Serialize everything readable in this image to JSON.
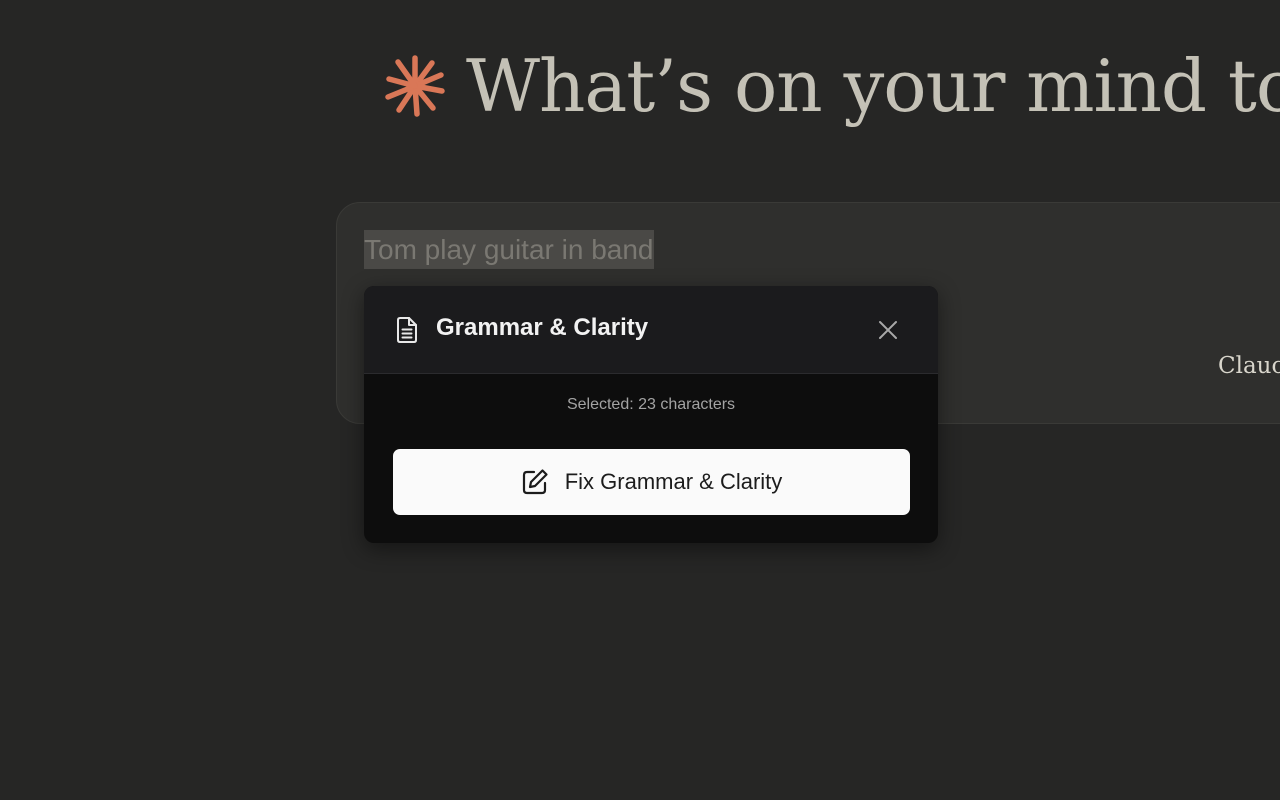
{
  "greeting": {
    "text": "What’s on your mind to",
    "logo_icon": "sparkle-asterisk-icon",
    "logo_color": "#d97757"
  },
  "composer": {
    "input_text": "Tom play guitar in band",
    "model_label": "Clauc"
  },
  "popup": {
    "title": "Grammar & Clarity",
    "title_icon": "document-icon",
    "close_icon": "close-icon",
    "selected_info": "Selected: 23 characters",
    "fix_button_label": "Fix Grammar & Clarity",
    "fix_button_icon": "edit-icon"
  },
  "colors": {
    "background": "#262625",
    "composer_bg": "#2f2f2d",
    "popup_bg": "#0d0d0d",
    "popup_header_bg": "#1b1b1d",
    "button_bg": "#fafafa",
    "selection_highlight": "#4a4946"
  }
}
